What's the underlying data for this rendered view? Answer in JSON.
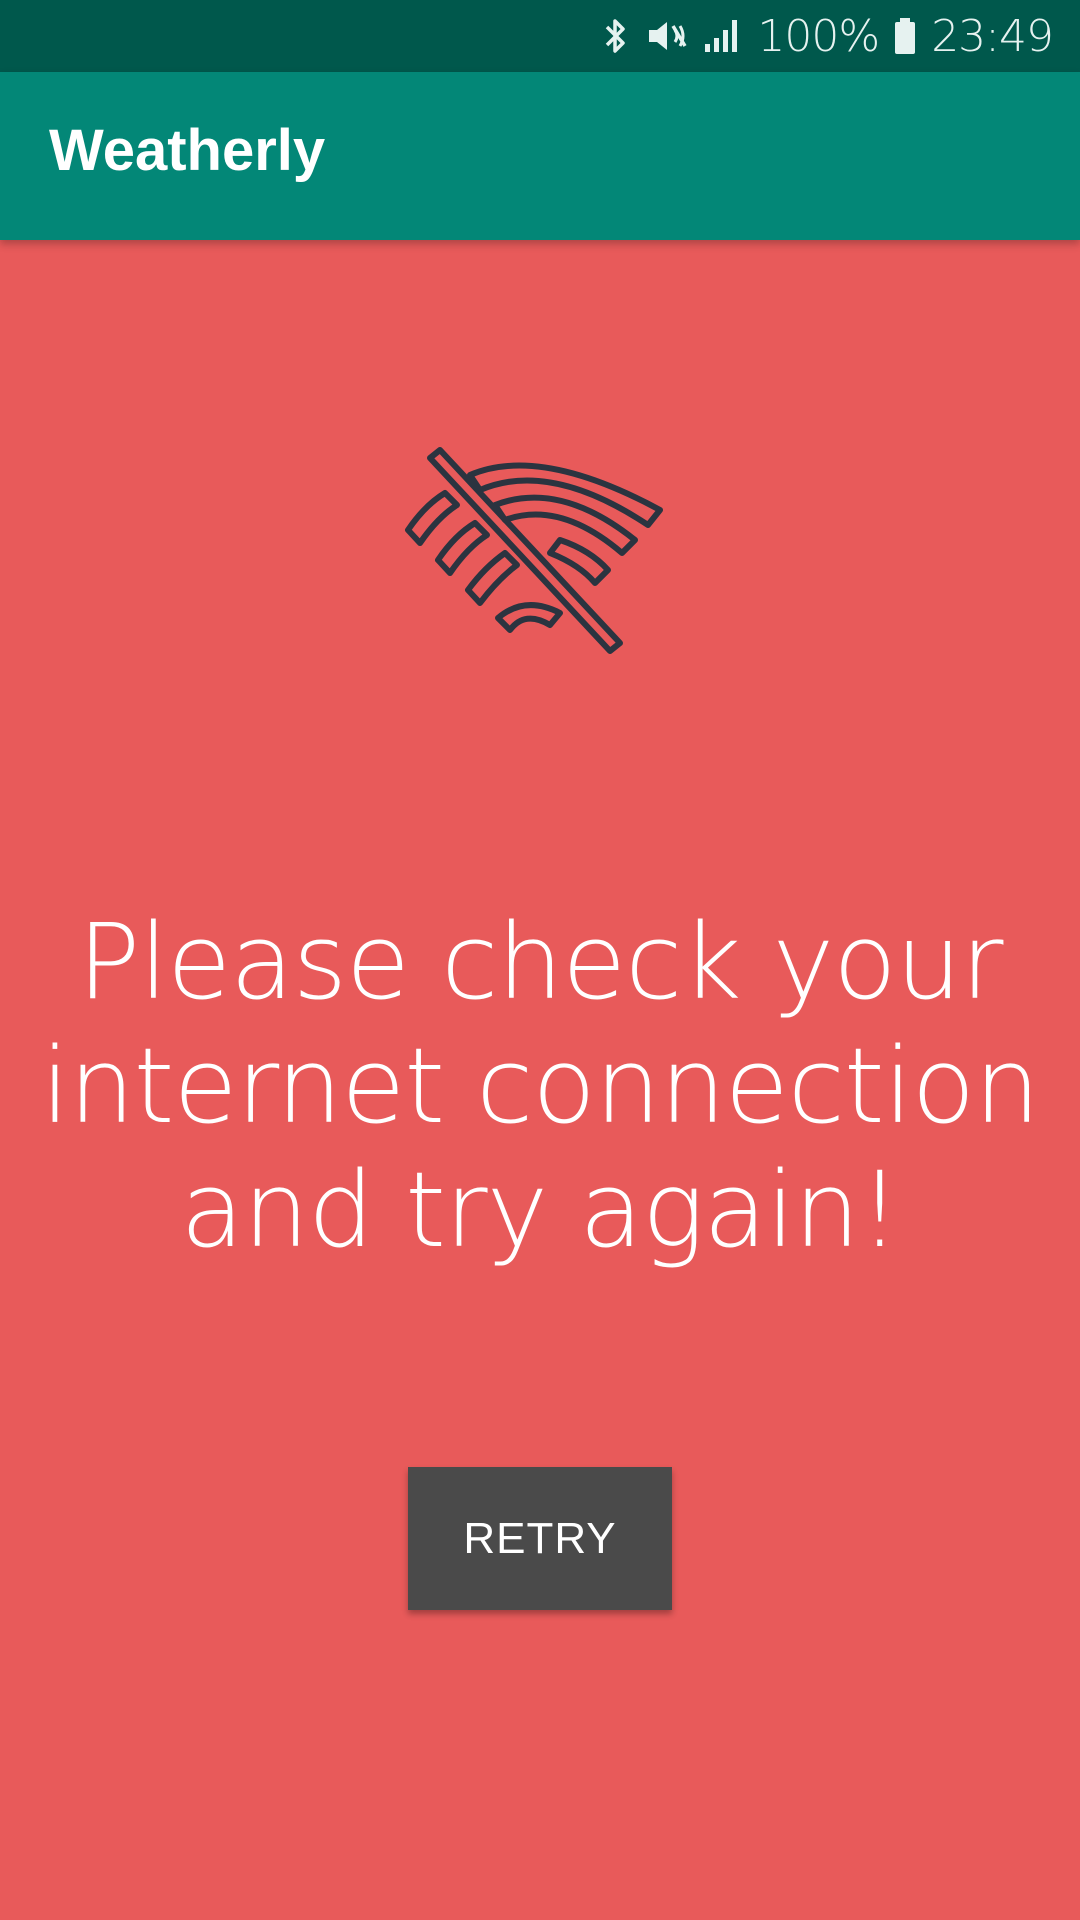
{
  "status_bar": {
    "battery": "100%",
    "time": "23:49",
    "icons": [
      "bluetooth-icon",
      "vibrate-mute-icon",
      "signal-icon",
      "battery-icon"
    ]
  },
  "app_bar": {
    "title": "Weatherly"
  },
  "error": {
    "icon": "wifi-off-icon",
    "message": "Please check your internet connection and try again!"
  },
  "retry": {
    "label": "RETRY"
  },
  "colors": {
    "status_bar": "#00584c",
    "app_bar": "#038777",
    "background": "#e85a5a",
    "button": "#4a4a4a",
    "icon_stroke": "#2b3440"
  }
}
